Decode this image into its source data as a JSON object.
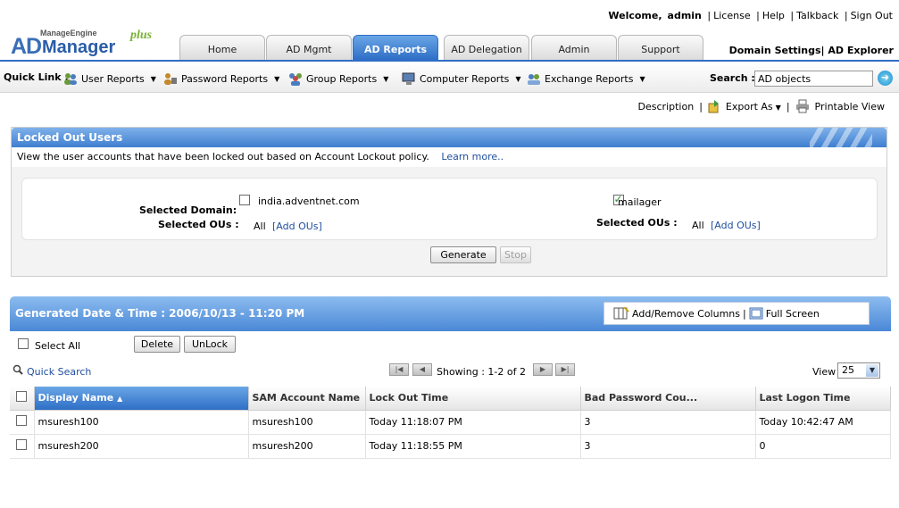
{
  "header": {
    "logo": {
      "vendor": "ManageEngine",
      "product_prefix": "AD",
      "product": "Manager",
      "suffix": "plus"
    },
    "welcome_prefix": "Welcome,",
    "username": "admin",
    "top_links": [
      "License",
      "Help",
      "Talkback",
      "Sign Out"
    ],
    "tabs": [
      {
        "label": "Home",
        "active": false
      },
      {
        "label": "AD Mgmt",
        "active": false
      },
      {
        "label": "AD Reports",
        "active": true
      },
      {
        "label": "AD Delegation",
        "active": false
      },
      {
        "label": "Admin",
        "active": false
      },
      {
        "label": "Support",
        "active": false
      }
    ],
    "domain_settings": "Domain Settings",
    "ad_explorer": "AD Explorer"
  },
  "quick_links": {
    "label": "Quick Link :",
    "items": [
      "User Reports",
      "Password Reports",
      "Group Reports",
      "Computer Reports",
      "Exchange Reports"
    ]
  },
  "search": {
    "label": "Search :",
    "value": "AD objects"
  },
  "actions": {
    "description": "Description",
    "export": "Export As",
    "printable": "Printable View"
  },
  "report_panel": {
    "title": "Locked Out Users",
    "description": "View the user accounts that have been locked out based on Account Lockout policy.",
    "learn_more": "Learn more..",
    "domains": [
      {
        "name": "india.adventnet.com",
        "checked": false,
        "domain_label": "Selected Domain:",
        "ous_label": "Selected OUs :",
        "ous_value": "All",
        "add_ous": "[Add OUs]"
      },
      {
        "name": "mailager",
        "checked": true,
        "ous_label": "Selected OUs :",
        "ous_value": "All",
        "add_ous": "[Add OUs]"
      }
    ],
    "generate_button": "Generate",
    "stop_button": "Stop"
  },
  "results": {
    "generated_label": "Generated Date & Time : 2006/10/13 - 11:20 PM",
    "add_remove_columns": "Add/Remove Columns",
    "full_screen": "Full Screen",
    "select_all": "Select All",
    "delete_button": "Delete",
    "unlock_button": "UnLock",
    "quick_search": "Quick Search",
    "showing": "Showing : 1-2 of 2",
    "view_label": "View",
    "view_value": "25",
    "columns": [
      "Display Name",
      "SAM Account Name",
      "Lock Out Time",
      "Bad Password Cou...",
      "Last Logon Time"
    ],
    "rows": [
      [
        "msuresh100",
        "msuresh100",
        "Today 11:18:07 PM",
        "3",
        "Today 10:42:47 AM"
      ],
      [
        "msuresh200",
        "msuresh200",
        "Today 11:18:55 PM",
        "3",
        "0"
      ]
    ]
  }
}
